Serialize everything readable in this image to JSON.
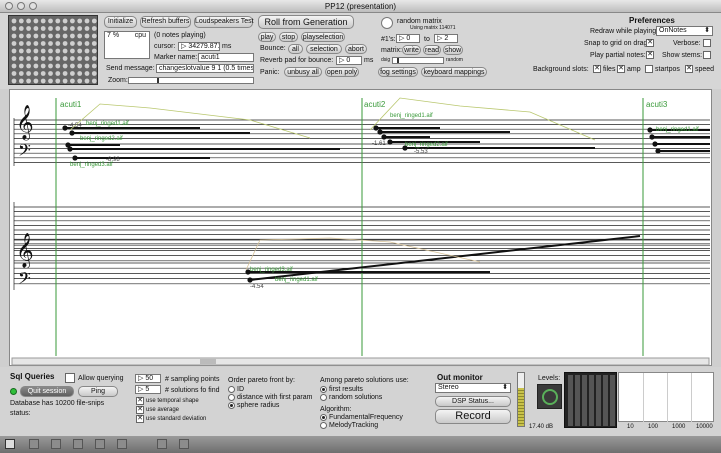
{
  "window": {
    "title": "PP12 (presentation)"
  },
  "header": {
    "initialize": "Initialize",
    "refresh": "Refresh buffers",
    "speakers": "Loudspeakers Test",
    "roll": "Roll from Generation",
    "cpu_value": "7 %",
    "cpu_label": "cpu",
    "notes_playing": "(0 notes playing)",
    "cursor_label": "cursor:",
    "cursor_value": "▷ 34279.871",
    "cursor_unit": "ms",
    "marker_label": "Marker name:",
    "marker_value": "acuti1",
    "send_label": "Send message:",
    "send_value": "changeslotvalue 9 1 (0.5 times)",
    "zoom_label": "Zoom:",
    "play": "play",
    "stop": "stop",
    "playselection": "playselection",
    "bounce_label": "Bounce:",
    "all": "all",
    "selection": "selection",
    "abort": "abort",
    "reverb_label": "Reverb pad for bounce:",
    "reverb_value": "▷ 0",
    "reverb_unit": "ms",
    "panic_label": "Panic:",
    "unbusy": "unbusy all",
    "openpoly": "open poly",
    "random_matrix": "random matrix",
    "using_matrix": "Using matrix 114071",
    "ones_label": "#1's:",
    "ones_from": "▷ 0",
    "to_label": "to",
    "ones_to": "▷ 2",
    "matrix_label": "matrix:",
    "write": "write",
    "read": "read",
    "show": "show",
    "dsig_label": "dsig",
    "random_label": "random",
    "fog": "fog settings",
    "keyboard": "keyboard mappings"
  },
  "preferences": {
    "title": "Preferences",
    "redraw_label": "Redraw while playing:",
    "redraw_value": "OnNotes",
    "snap_label": "Snap to grid on drag",
    "verbose_label": "Verbose:",
    "partial_label": "Play partial notes:",
    "stems_label": "Show stems:",
    "bg_label": "Background slots:",
    "files": "files",
    "amp": "amp",
    "startpos": "startpos",
    "speed": "speed"
  },
  "score": {
    "markers": [
      "acuti1",
      "acuti2",
      "acuti3"
    ],
    "note_labels": [
      "benj_ringed1.aif",
      "benj_ringed2.aif",
      "benj_ringed3.aif",
      "benj_ringed1.aif",
      "benj_ringed2.aif",
      "benj_ringed1.aif",
      "benj_ringed3.aif",
      "benj_ringed1.aif"
    ],
    "values": [
      "-4.54",
      "-1.61",
      "-8.98",
      "-5.53",
      "-4.54"
    ]
  },
  "sql": {
    "title": "Sql Queries",
    "allow": "Allow querying",
    "quit": "Quit session",
    "ping": "Ping",
    "db_info": "Database has 10200 file-snips",
    "status_label": "status:",
    "sampling_value": "▷ 50",
    "sampling_label": "# sampling points",
    "solutions_value": "▷ 5",
    "solutions_label": "# solutions fo find",
    "temporal": "use temporal shape",
    "average": "use average",
    "stddev": "use standard deviation"
  },
  "pareto": {
    "title": "Order pareto front by:",
    "id": "ID",
    "first_param": "distance with first param",
    "sphere": "sphere radius"
  },
  "among": {
    "title": "Among pareto solutions use:",
    "first": "first results",
    "random": "random solutions",
    "algo_title": "Algorithm:",
    "fundamental": "FundamentalFrequency",
    "melody": "MelodyTracking"
  },
  "out": {
    "title": "Out monitor",
    "stereo": "Stereo",
    "dsp": "DSP Status...",
    "record": "Record",
    "db": "17.40 dB",
    "levels": "Levels:",
    "freq_ticks": [
      "10",
      "100",
      "1000",
      "10000"
    ]
  }
}
